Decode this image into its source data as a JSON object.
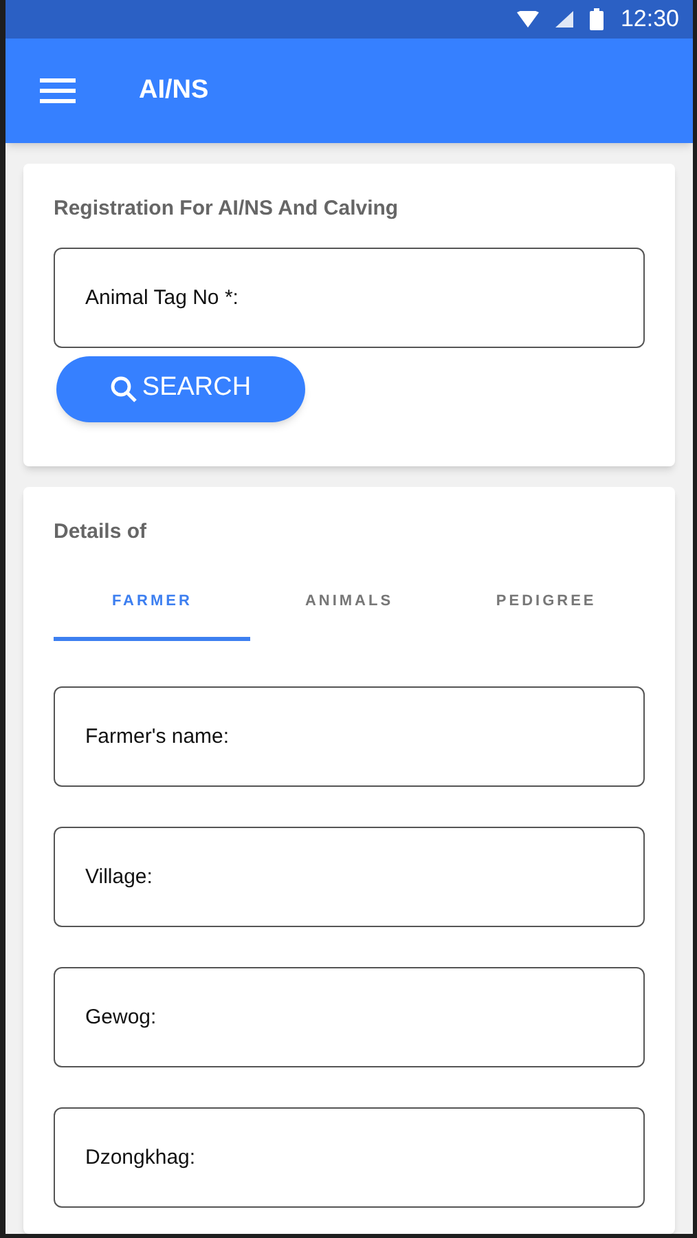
{
  "status_bar": {
    "time": "12:30"
  },
  "app_bar": {
    "title": "AI/NS"
  },
  "registration": {
    "title": "Registration For AI/NS And Calving",
    "tag_field": {
      "placeholder": "Animal Tag No *:"
    },
    "search_button": "SEARCH"
  },
  "details": {
    "title": "Details of",
    "tabs": [
      {
        "label": "FARMER",
        "selected": true
      },
      {
        "label": "ANIMALS",
        "selected": false
      },
      {
        "label": "PEDIGREE",
        "selected": false
      }
    ],
    "fields": [
      {
        "placeholder": "Farmer's name:"
      },
      {
        "placeholder": "Village:"
      },
      {
        "placeholder": "Gewog:"
      },
      {
        "placeholder": "Dzongkhag:"
      }
    ]
  }
}
